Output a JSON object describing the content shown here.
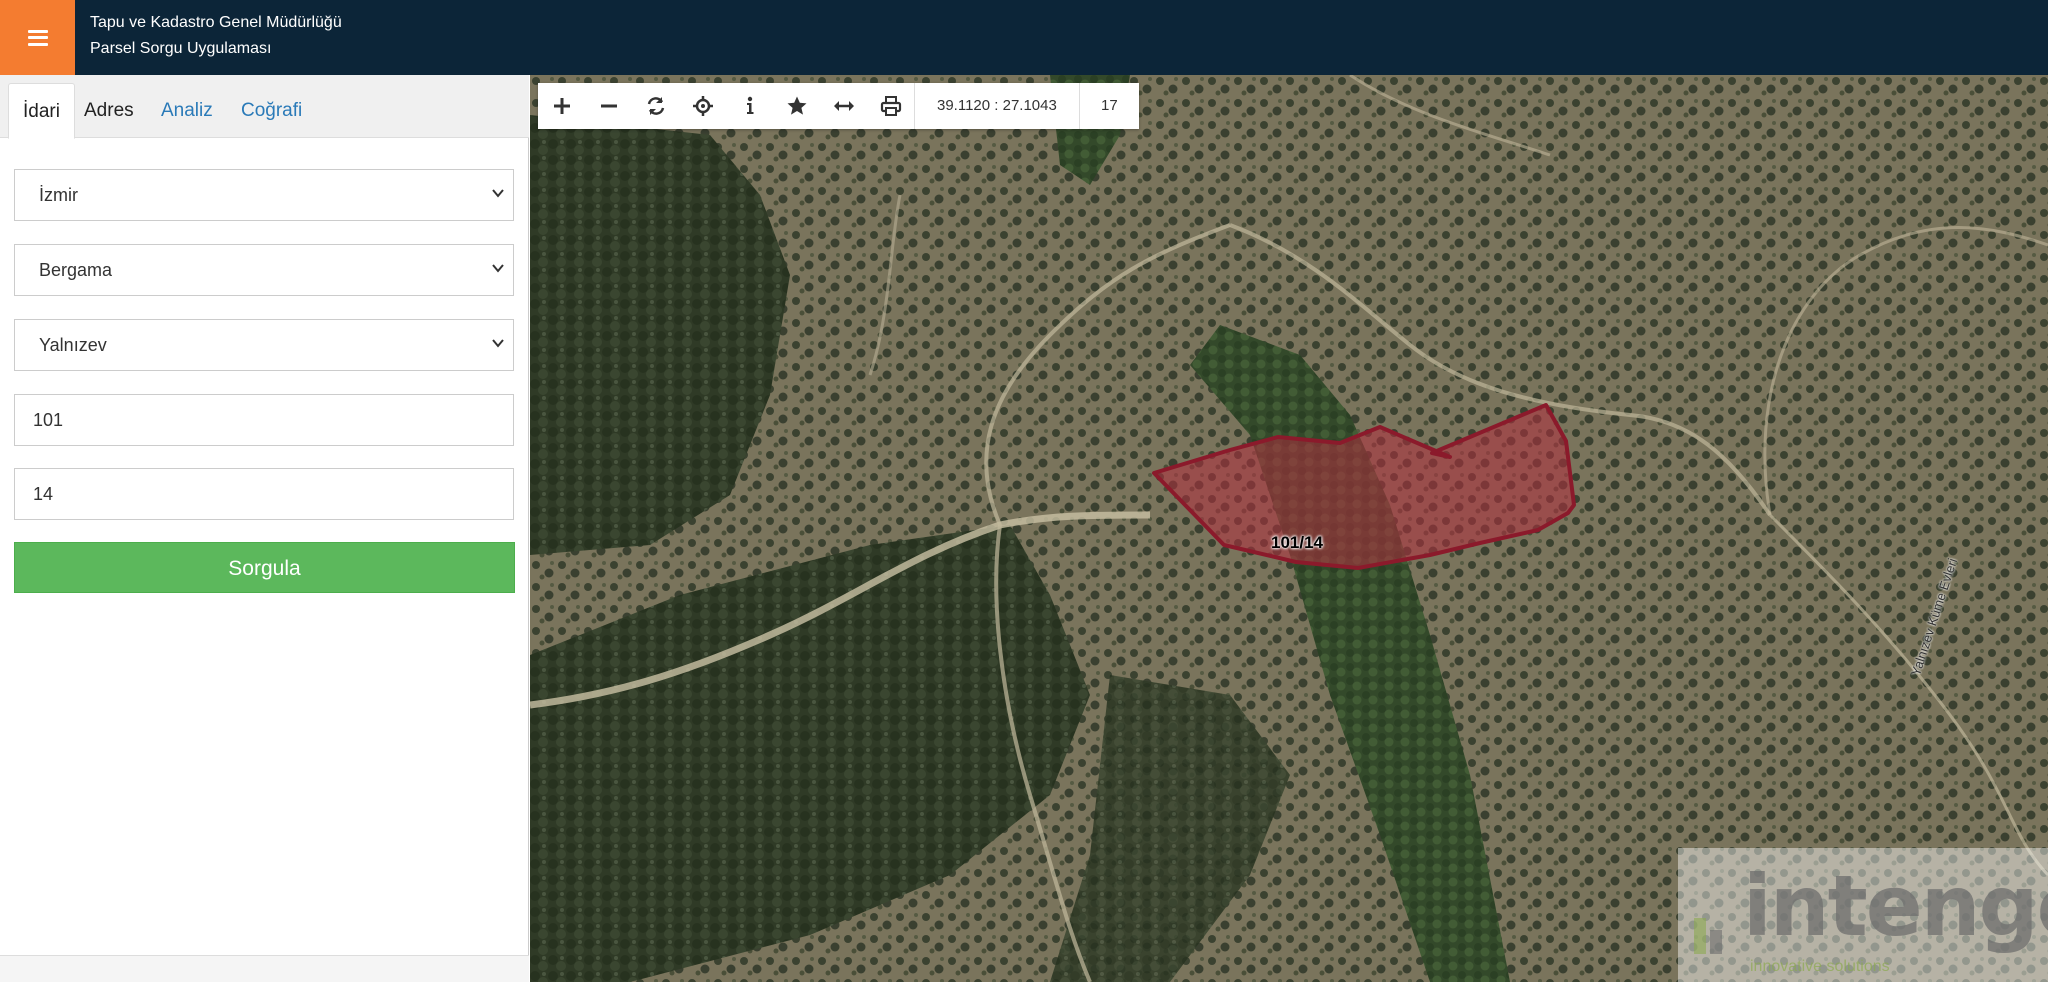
{
  "header": {
    "title_line1": "Tapu ve Kadastro Genel Müdürlüğü",
    "title_line2": "Parsel Sorgu Uygulaması",
    "menu_icon": "hamburger-icon",
    "accent_color": "#f47c30",
    "bar_color": "#0c2538"
  },
  "sidebar": {
    "tabs": [
      {
        "label": "İdari",
        "active": true
      },
      {
        "label": "Adres"
      },
      {
        "label": "Analiz"
      },
      {
        "label": "Coğrafi"
      }
    ],
    "il": "İzmir",
    "ilce": "Bergama",
    "mahalle": "Yalnızev",
    "ada": "101",
    "parsel": "14",
    "query_button": "Sorgula",
    "button_color": "#5cb85c"
  },
  "map": {
    "toolbar": {
      "icons": [
        "zoom-in-icon",
        "zoom-out-icon",
        "refresh-icon",
        "locate-icon",
        "info-icon",
        "star-icon",
        "measure-icon",
        "print-icon"
      ],
      "coordinates": "39.1120 : 27.1043",
      "zoom_level": "17"
    },
    "parcel_label": "101/14",
    "road_label": "Yalnızev Küme Evleri",
    "parcel_color": "#8b1a2b",
    "watermark": {
      "brand": "intengo",
      "tagline": "innovative solutions"
    }
  }
}
